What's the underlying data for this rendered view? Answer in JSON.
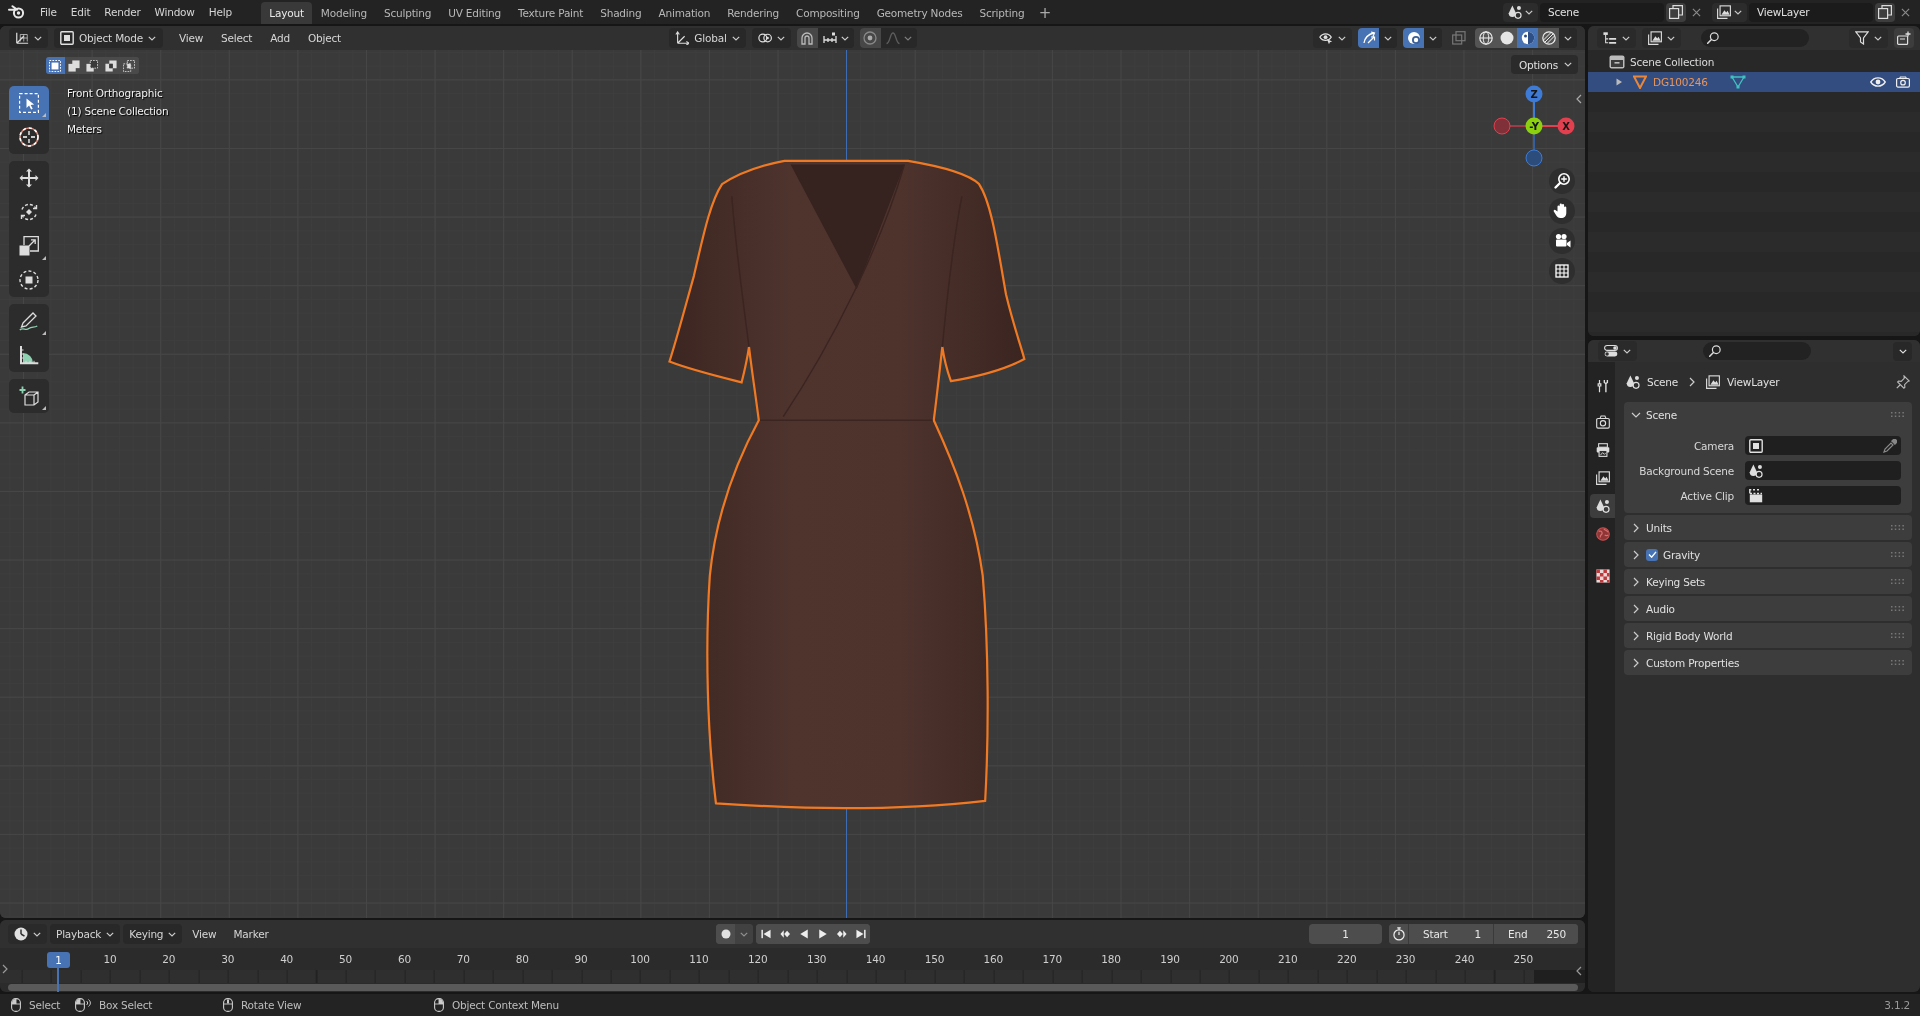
{
  "top_bar": {
    "menus": [
      "File",
      "Edit",
      "Render",
      "Window",
      "Help"
    ],
    "workspaces": [
      {
        "label": "Layout",
        "selected": true
      },
      {
        "label": "Modeling",
        "selected": false
      },
      {
        "label": "Sculpting",
        "selected": false
      },
      {
        "label": "UV Editing",
        "selected": false
      },
      {
        "label": "Texture Paint",
        "selected": false
      },
      {
        "label": "Shading",
        "selected": false
      },
      {
        "label": "Animation",
        "selected": false
      },
      {
        "label": "Rendering",
        "selected": false
      },
      {
        "label": "Compositing",
        "selected": false
      },
      {
        "label": "Geometry Nodes",
        "selected": false
      },
      {
        "label": "Scripting",
        "selected": false
      }
    ],
    "add_workspace": "+",
    "scene": "Scene",
    "view_layer": "ViewLayer"
  },
  "viewport": {
    "header": {
      "mode": "Object Mode",
      "menus": [
        "View",
        "Select",
        "Add",
        "Object"
      ],
      "orientation": "Global",
      "gizmos": {
        "on": true
      },
      "overlays": {
        "on": true
      },
      "shading": [
        {
          "selected": false
        },
        {
          "selected": false
        },
        {
          "selected": true
        },
        {
          "selected": false
        }
      ]
    },
    "select_modes": [
      {
        "selected": true
      },
      {
        "selected": false
      },
      {
        "selected": false
      },
      {
        "selected": false
      },
      {
        "selected": false
      }
    ],
    "options": "Options",
    "info": [
      "Front Orthographic",
      "(1) Scene Collection",
      "Meters"
    ],
    "tools": [
      {
        "selected": true
      },
      {
        "selected": false
      },
      {
        "selected": false
      },
      {
        "selected": false
      },
      {
        "selected": false
      },
      {
        "selected": false
      },
      {
        "selected": false
      },
      {
        "selected": false
      },
      {
        "selected": false
      }
    ],
    "axes": [
      "Z",
      "-Y",
      "X"
    ]
  },
  "outliner": {
    "root": "Scene Collection",
    "items": [
      {
        "name": "DG100246",
        "selected": true,
        "expanded": false
      }
    ]
  },
  "properties": {
    "tabs": [
      {
        "selected": false
      },
      {
        "selected": false
      },
      {
        "selected": false
      },
      {
        "selected": false
      },
      {
        "selected": true
      },
      {
        "selected": false
      },
      {
        "selected": false
      }
    ],
    "breadcrumb": [
      "Scene",
      "ViewLayer"
    ],
    "panels": [
      {
        "title": "Scene",
        "expanded": true,
        "fields": [
          "Camera",
          "Background Scene",
          "Active Clip"
        ]
      },
      {
        "title": "Units",
        "expanded": false
      },
      {
        "title": "Gravity",
        "expanded": false,
        "checkbox": {
          "checked": true
        }
      },
      {
        "title": "Keying Sets",
        "expanded": false
      },
      {
        "title": "Audio",
        "expanded": false
      },
      {
        "title": "Rigid Body World",
        "expanded": false
      },
      {
        "title": "Custom Properties",
        "expanded": false
      }
    ]
  },
  "timeline": {
    "dropdowns": [
      "Playback",
      "Keying"
    ],
    "menus": [
      "View",
      "Marker"
    ],
    "current_frame": "1",
    "start_label": "Start",
    "start": "1",
    "end_label": "End",
    "end": "250",
    "playhead": "1",
    "ticks": [
      "10",
      "20",
      "30",
      "40",
      "50",
      "60",
      "70",
      "80",
      "90",
      "100",
      "110",
      "120",
      "130",
      "140",
      "150",
      "160",
      "170",
      "180",
      "190",
      "200",
      "210",
      "220",
      "230",
      "240",
      "250"
    ]
  },
  "status_bar": {
    "hints": [
      "Select",
      "Box Select",
      "Rotate View",
      "Object Context Menu"
    ],
    "version": "3.1.2"
  }
}
